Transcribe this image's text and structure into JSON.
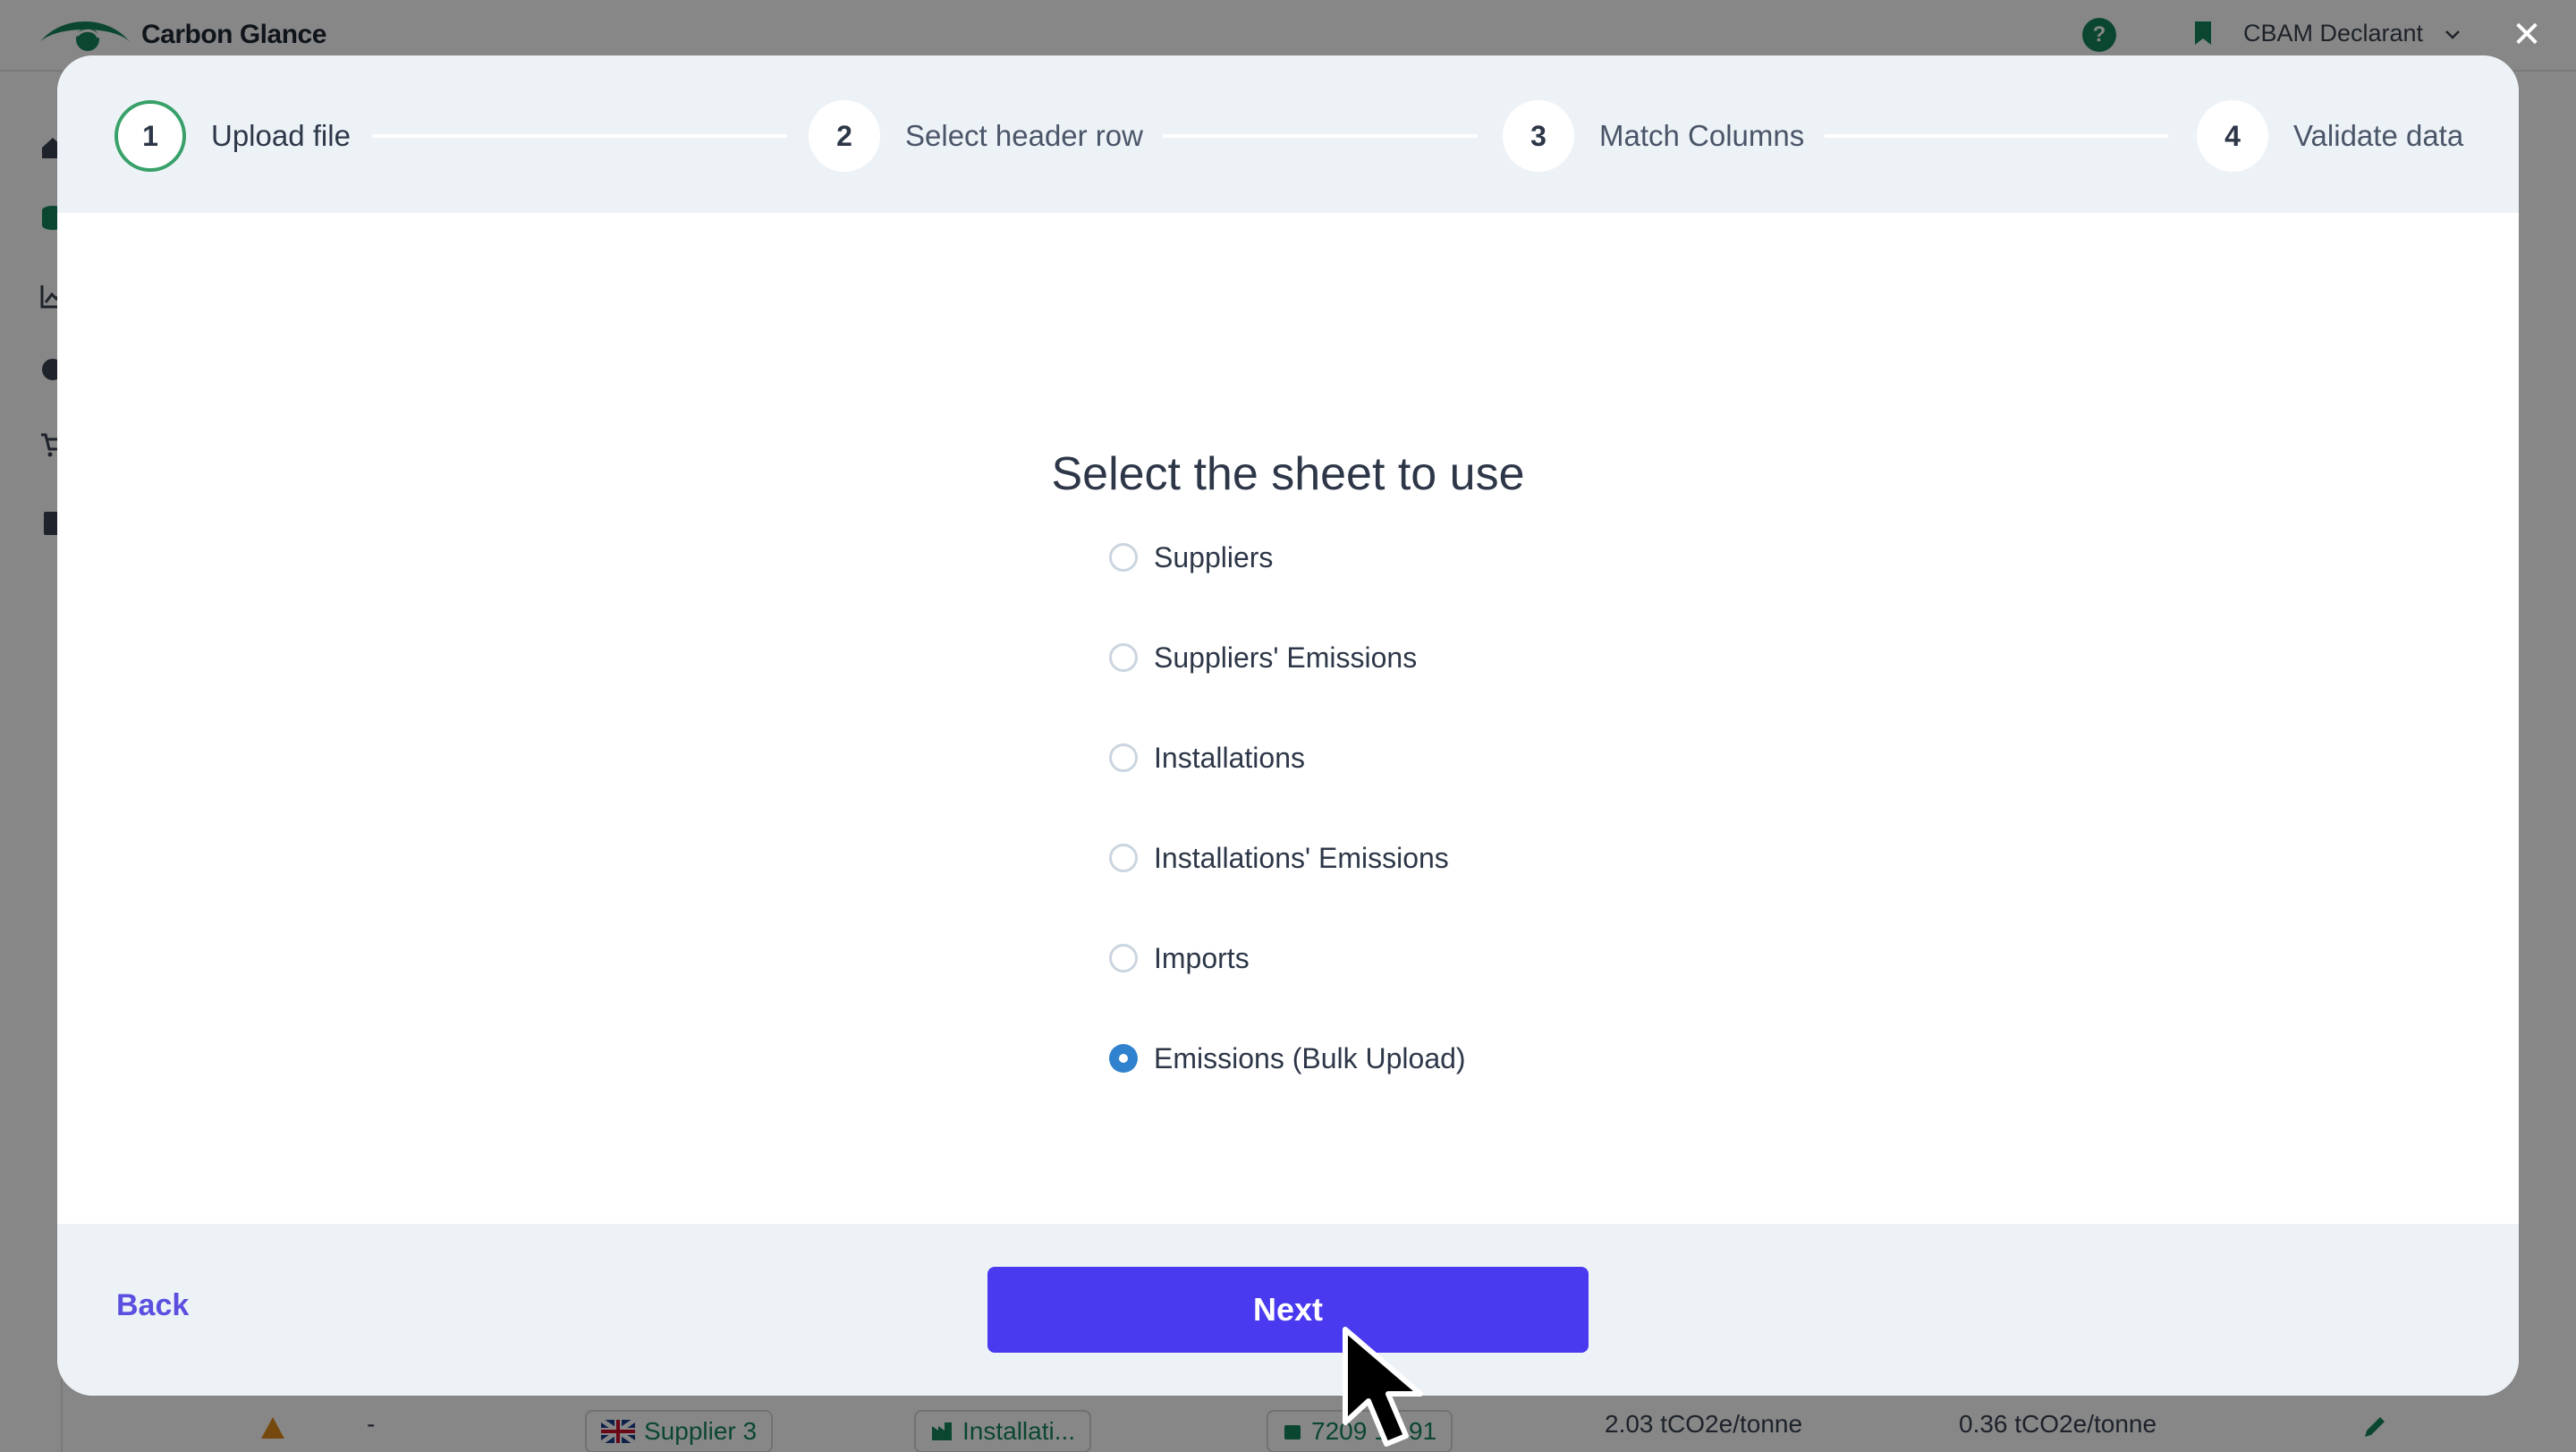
{
  "app": {
    "brand": "Carbon Glance",
    "role": "CBAM Declarant",
    "brand_color": "#16865c"
  },
  "background_row": {
    "supplier": "Supplier 3",
    "installation": "Installati...",
    "dash": "-",
    "code": "7209 16 91",
    "emission_1": "2.03 tCO2e/tonne",
    "emission_2": "0.36 tCO2e/tonne"
  },
  "wizard": {
    "steps": [
      {
        "number": "1",
        "label": "Upload file",
        "state": "active"
      },
      {
        "number": "2",
        "label": "Select header row",
        "state": "upcoming"
      },
      {
        "number": "3",
        "label": "Match Columns",
        "state": "upcoming"
      },
      {
        "number": "4",
        "label": "Validate data",
        "state": "upcoming"
      }
    ],
    "title": "Select the sheet to use",
    "sheets": [
      {
        "label": "Suppliers",
        "checked": false
      },
      {
        "label": "Suppliers' Emissions",
        "checked": false
      },
      {
        "label": "Installations",
        "checked": false
      },
      {
        "label": "Installations' Emissions",
        "checked": false
      },
      {
        "label": "Imports",
        "checked": false
      },
      {
        "label": "Emissions (Bulk Upload)",
        "checked": true
      }
    ],
    "back_label": "Back",
    "next_label": "Next",
    "accent_color": "#4a3aef",
    "radio_color": "#3182ce"
  }
}
